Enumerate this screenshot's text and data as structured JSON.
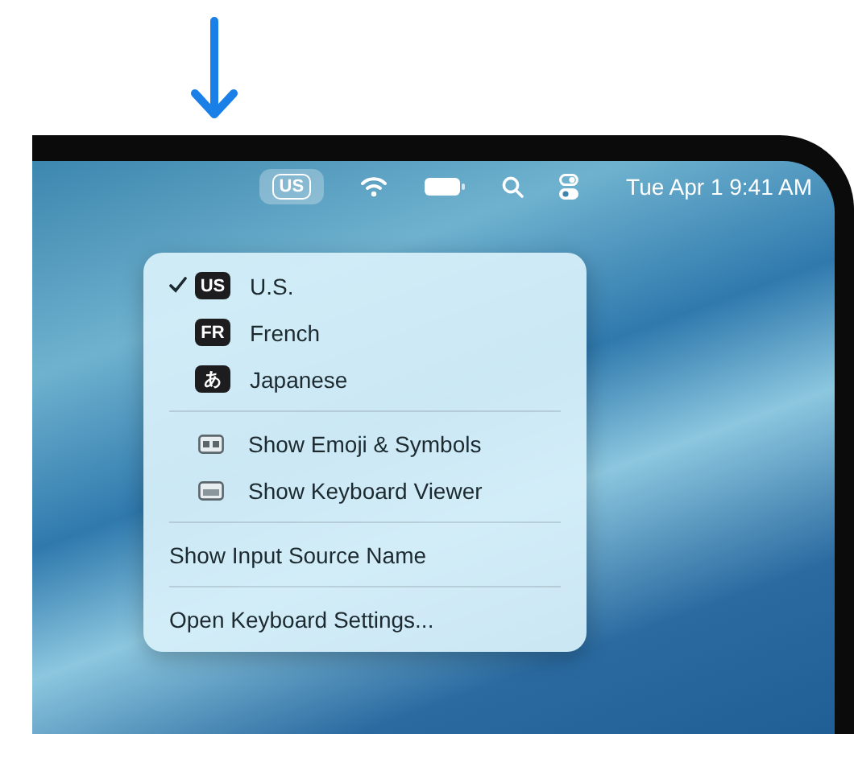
{
  "menu_bar": {
    "input_source": {
      "label": "US",
      "selected": true
    },
    "clock": "Tue Apr 1 9:41 AM"
  },
  "menu": {
    "groups": [
      [
        {
          "kind": "source",
          "badge": "US",
          "label": "U.S.",
          "checked": true
        },
        {
          "kind": "source",
          "badge": "FR",
          "label": "French",
          "checked": false
        },
        {
          "kind": "source",
          "badge": "あ",
          "label": "Japanese",
          "checked": false
        }
      ],
      [
        {
          "kind": "emoji",
          "label": "Show Emoji & Symbols"
        },
        {
          "kind": "keyboard",
          "label": "Show Keyboard Viewer"
        }
      ],
      [
        {
          "kind": "plain",
          "label": "Show Input Source Name"
        }
      ],
      [
        {
          "kind": "plain",
          "label": "Open Keyboard Settings..."
        }
      ]
    ]
  }
}
